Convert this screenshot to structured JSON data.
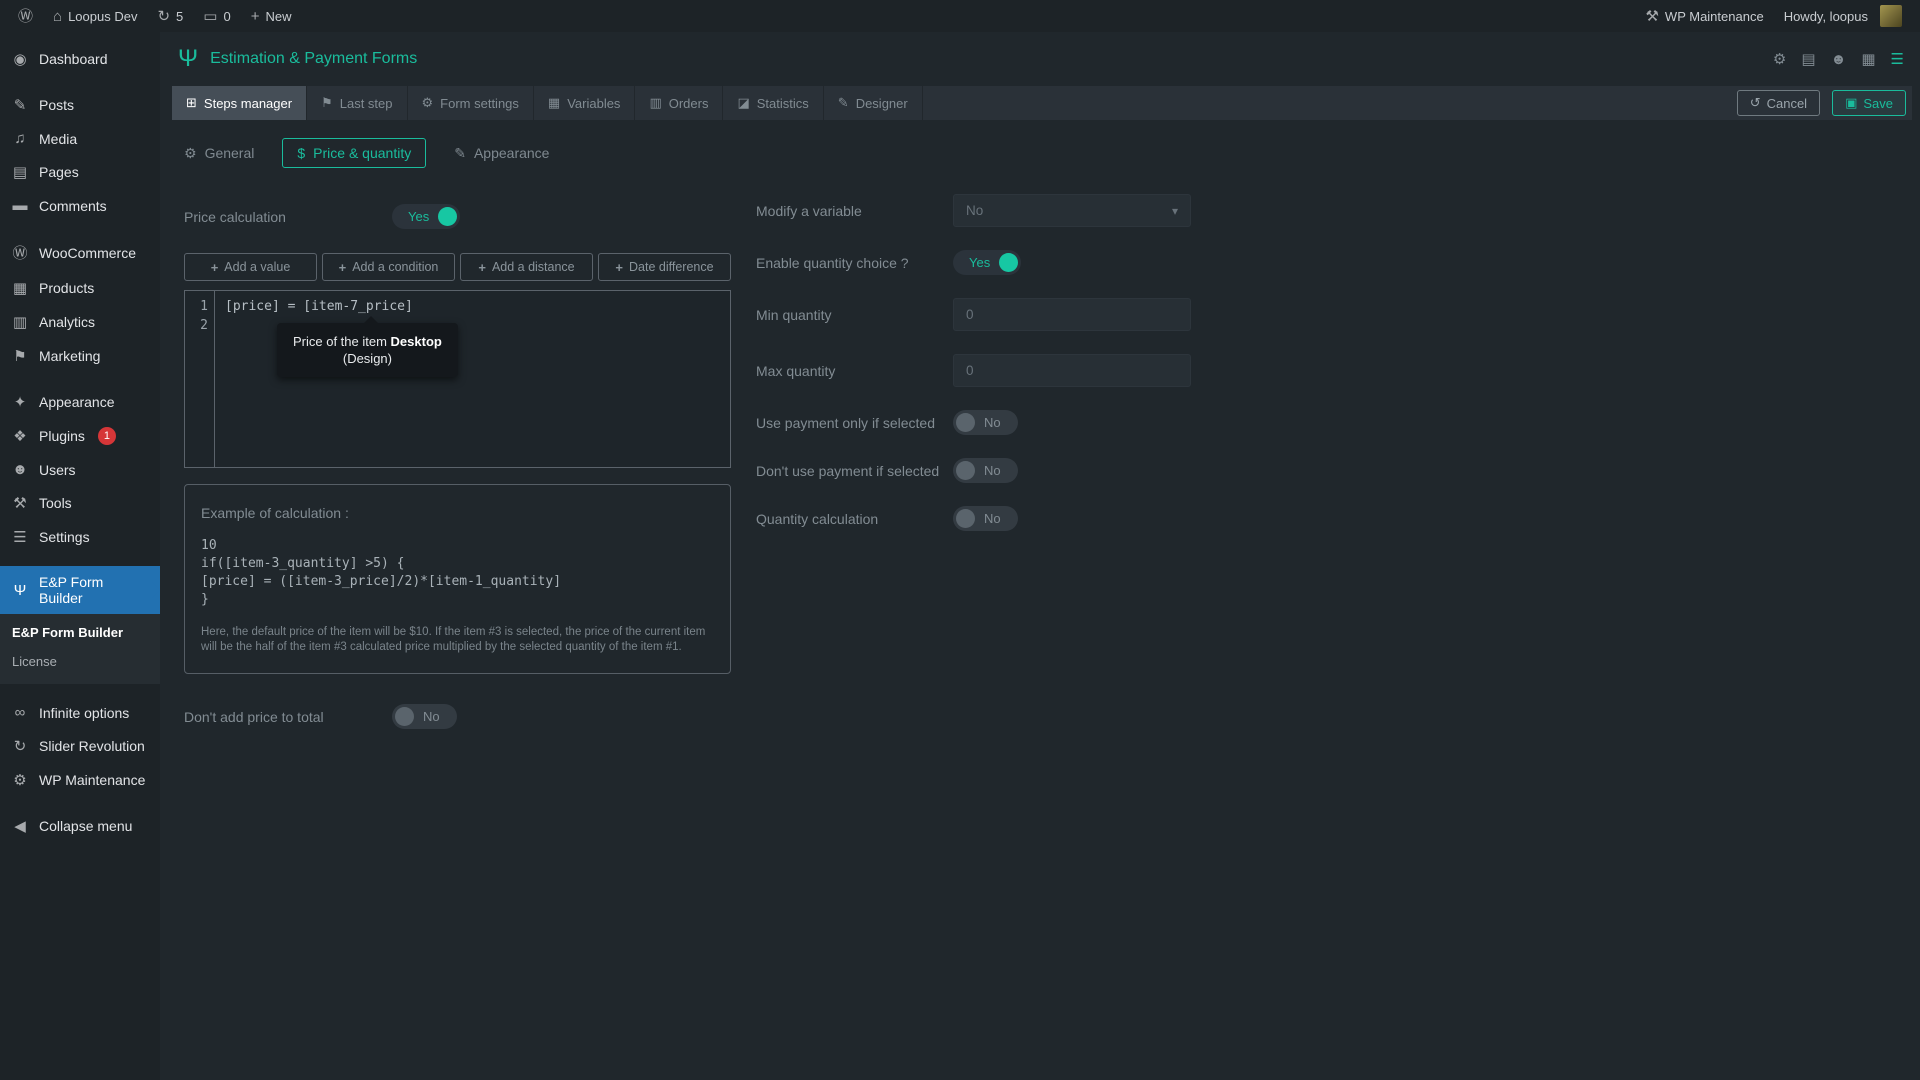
{
  "colors": {
    "accent_teal": "#1abc9c",
    "active_menu_blue": "#2271b1",
    "badge_red": "#d63638"
  },
  "icons": {
    "wordpress": "Ⓦ",
    "home": "⌂",
    "updates": "↻",
    "comment_bubble": "▭",
    "plus": "+",
    "wrench": "⚒",
    "dashboard": "◉",
    "posts": "✎",
    "media": "♫",
    "pages": "▤",
    "comments": "▬",
    "woocommerce": "Ⓦ",
    "products": "▦",
    "analytics": "▥",
    "marketing": "⚑",
    "appearance": "✦",
    "plugins": "❖",
    "users": "☻",
    "tools": "⚒",
    "settings": "☰",
    "form_builder": "Ψ",
    "infinite": "∞",
    "slider": "↻",
    "maintenance": "⚙",
    "collapse": "◀",
    "logo": "Ψ",
    "gear": "⚙",
    "document": "▤",
    "people": "☻",
    "calendar": "▦",
    "list": "☰",
    "steps": "⊞",
    "flag": "⚑",
    "grid": "▦",
    "orders": "▥",
    "stats": "◪",
    "brush": "✎",
    "dollar": "$",
    "undo": "↺",
    "save": "▣",
    "chevron_down": "▾"
  },
  "admin_bar": {
    "site_name": "Loopus Dev",
    "updates_count": "5",
    "comments_count": "0",
    "new_label": "New",
    "maintenance_label": "WP Maintenance",
    "howdy_label": "Howdy, loopus"
  },
  "sidebar": {
    "items": [
      {
        "label": "Dashboard"
      },
      {
        "label": "Posts"
      },
      {
        "label": "Media"
      },
      {
        "label": "Pages"
      },
      {
        "label": "Comments"
      },
      {
        "label": "WooCommerce"
      },
      {
        "label": "Products"
      },
      {
        "label": "Analytics"
      },
      {
        "label": "Marketing"
      },
      {
        "label": "Appearance"
      },
      {
        "label": "Plugins",
        "badge": "1"
      },
      {
        "label": "Users"
      },
      {
        "label": "Tools"
      },
      {
        "label": "Settings"
      },
      {
        "label": "E&P Form Builder"
      }
    ],
    "submenu": [
      {
        "label": "E&P Form Builder"
      },
      {
        "label": "License"
      }
    ],
    "lower_items": [
      {
        "label": "Infinite options"
      },
      {
        "label": "Slider Revolution"
      },
      {
        "label": "WP Maintenance"
      }
    ],
    "collapse_label": "Collapse menu"
  },
  "header": {
    "title": "Estimation & Payment Forms"
  },
  "tabs": {
    "items": [
      {
        "label": "Steps manager"
      },
      {
        "label": "Last step"
      },
      {
        "label": "Form settings"
      },
      {
        "label": "Variables"
      },
      {
        "label": "Orders"
      },
      {
        "label": "Statistics"
      },
      {
        "label": "Designer"
      }
    ],
    "cancel_label": "Cancel",
    "save_label": "Save"
  },
  "subtabs": {
    "general": "General",
    "price": "Price & quantity",
    "appearance": "Appearance"
  },
  "left_panel": {
    "price_calculation_label": "Price calculation",
    "price_calculation_value": "Yes",
    "add_value": "Add a value",
    "add_condition": "Add a condition",
    "add_distance": "Add a distance",
    "date_difference": "Date difference",
    "editor": {
      "line_numbers": [
        "1",
        "2"
      ],
      "line1": "[price] = [item-7_price]",
      "line2": ""
    },
    "tooltip": {
      "prefix": "Price of the item ",
      "item_name": "Desktop",
      "detail": "(Design)"
    },
    "example": {
      "title": "Example of calculation :",
      "code": "10\nif([item-3_quantity] >5) {\n[price] = ([item-3_price]/2)*[item-1_quantity]\n}",
      "note": "Here, the default price of the item will be $10. If the item #3 is selected, the price of the current item will be the half of the item #3 calculated price multiplied by the selected quantity of the item #1."
    },
    "dont_add_label": "Don't add price to total",
    "dont_add_value": "No"
  },
  "right_panel": {
    "modify_variable": {
      "label": "Modify a variable",
      "value": "No"
    },
    "enable_quantity": {
      "label": "Enable quantity choice ?",
      "value": "Yes"
    },
    "min_quantity": {
      "label": "Min quantity",
      "value": "0"
    },
    "max_quantity": {
      "label": "Max quantity",
      "value": "0"
    },
    "use_payment_only": {
      "label": "Use payment only if selected",
      "value": "No"
    },
    "dont_use_payment": {
      "label": "Don't use payment if selected",
      "value": "No"
    },
    "quantity_calculation": {
      "label": "Quantity calculation",
      "value": "No"
    }
  }
}
